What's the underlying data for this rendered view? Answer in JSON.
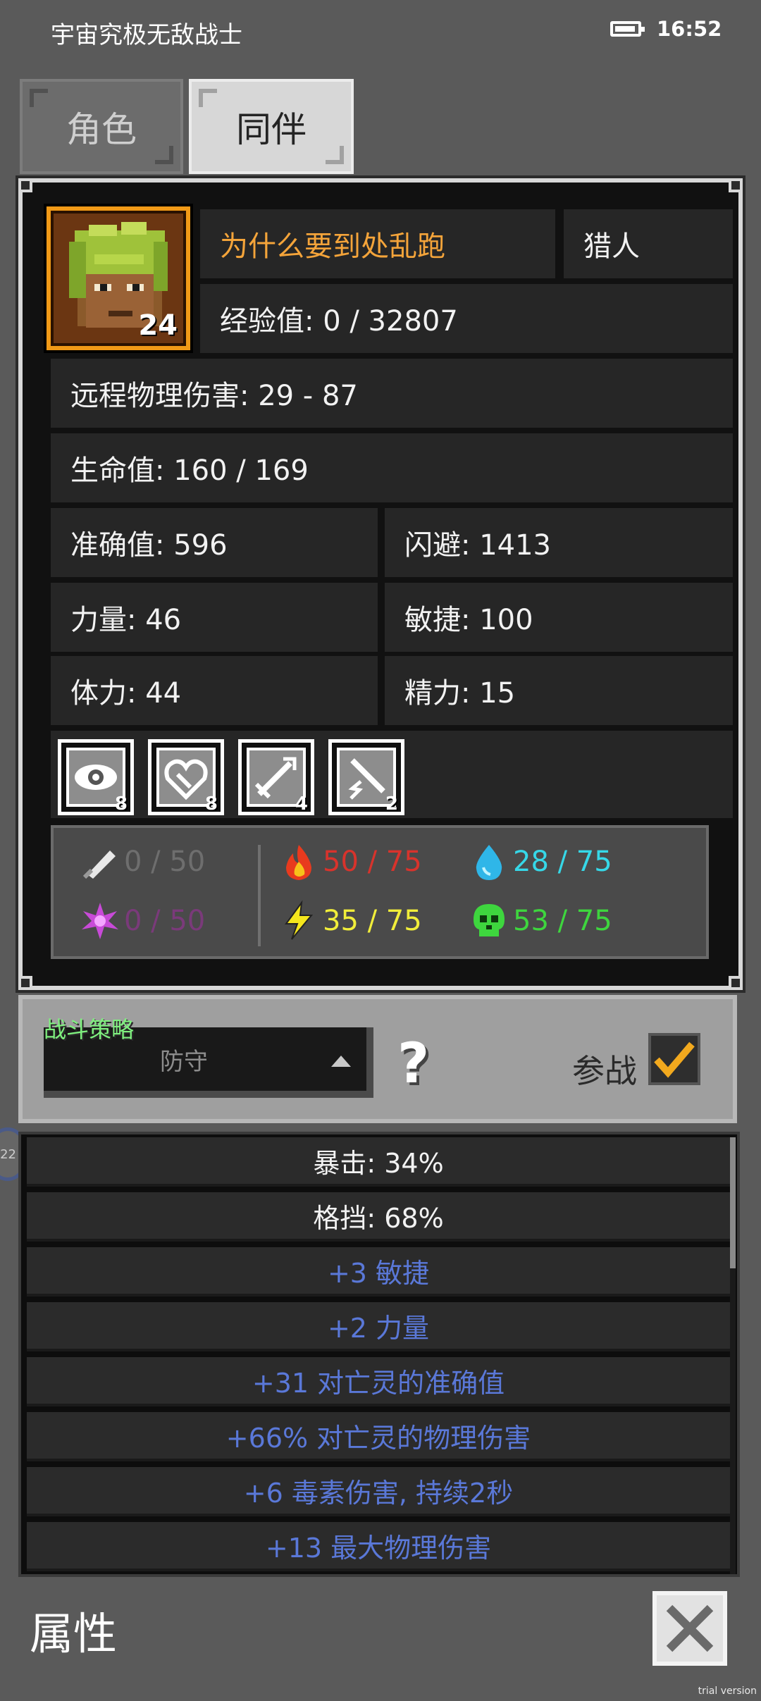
{
  "status_bar": {
    "app_title": "宇宙究极无敌战士",
    "time": "16:52"
  },
  "tabs": [
    {
      "label": "角色",
      "active": false
    },
    {
      "label": "同伴",
      "active": true
    }
  ],
  "character": {
    "level": "24",
    "name": "为什么要到处乱跑",
    "class": "猎人",
    "experience": "经验值: 0 / 32807",
    "damage": "远程物理伤害: 29 - 87",
    "health": "生命值: 160 / 169",
    "accuracy": "准确值: 596",
    "evasion": "闪避: 1413",
    "strength": "力量: 46",
    "agility": "敏捷: 100",
    "stamina": "体力: 44",
    "energy": "精力: 15"
  },
  "skills": [
    {
      "icon": "eye-skill-icon",
      "count": "8"
    },
    {
      "icon": "heart-shield-skill-icon",
      "count": "8"
    },
    {
      "icon": "sword-skill-icon",
      "count": "4"
    },
    {
      "icon": "lightning-sword-skill-icon",
      "count": "2"
    }
  ],
  "resistances": [
    {
      "icon": "physical-resist-icon",
      "text": "0 / 50",
      "color": "#6e6e6e"
    },
    {
      "icon": "fire-resist-icon",
      "text": "50 / 75",
      "color": "#d8332c"
    },
    {
      "icon": "water-resist-icon",
      "text": "28 / 75",
      "color": "#36d8e8"
    },
    {
      "icon": "arcane-resist-icon",
      "text": "0 / 50",
      "color": "#7a3a7a"
    },
    {
      "icon": "lightning-resist-icon",
      "text": "35 / 75",
      "color": "#f1ee3a"
    },
    {
      "icon": "poison-resist-icon",
      "text": "53 / 75",
      "color": "#3ed63e"
    }
  ],
  "battle": {
    "label": "战斗策略",
    "strategy": "防守",
    "join_label": "参战",
    "joined": true
  },
  "effects": [
    {
      "text": "暴击: 34%",
      "color": "#f2f2f2"
    },
    {
      "text": "格挡: 68%",
      "color": "#f2f2f2"
    },
    {
      "text": "+3 敏捷",
      "color": "#5a78d8"
    },
    {
      "text": "+2 力量",
      "color": "#5a78d8"
    },
    {
      "text": "+31 对亡灵的准确值",
      "color": "#5a78d8"
    },
    {
      "text": "+66% 对亡灵的物理伤害",
      "color": "#5a78d8"
    },
    {
      "text": "+6 毒素伤害, 持续2秒",
      "color": "#5a78d8"
    },
    {
      "text": "+13 最大物理伤害",
      "color": "#5a78d8"
    }
  ],
  "side_handle_label": "22",
  "footer": {
    "title": "属性",
    "trial_label": "trial version"
  }
}
